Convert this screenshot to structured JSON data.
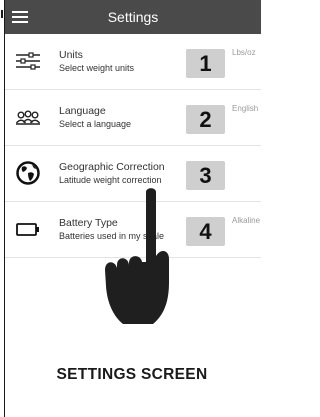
{
  "app": {
    "title": "Settings"
  },
  "settings": [
    {
      "title": "Units",
      "subtitle": "Select weight units",
      "value": "Lbs/oz",
      "number": "1",
      "icon": "sliders-icon"
    },
    {
      "title": "Language",
      "subtitle": "Select a language",
      "value": "English",
      "number": "2",
      "icon": "people-icon"
    },
    {
      "title": "Geographic Correction",
      "subtitle": "Latitude weight correction",
      "value": "",
      "number": "3",
      "icon": "globe-icon"
    },
    {
      "title": "Battery Type",
      "subtitle": "Batteries used in my scale",
      "value": "Alkaline",
      "number": "4",
      "icon": "battery-icon"
    }
  ],
  "caption": "SETTINGS SCREEN"
}
